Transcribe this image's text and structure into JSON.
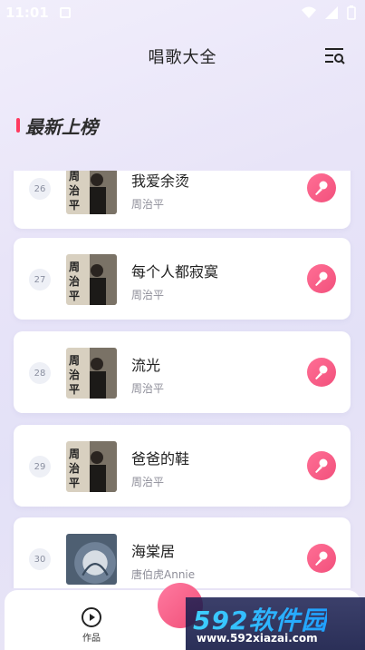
{
  "status": {
    "time": "11:01"
  },
  "header": {
    "title": "唱歌大全"
  },
  "section": {
    "title": "最新上榜"
  },
  "songs": [
    {
      "rank": "26",
      "title": "我爱余烫",
      "artist": "周治平",
      "cover": "portrait"
    },
    {
      "rank": "27",
      "title": "每个人都寂寞",
      "artist": "周治平",
      "cover": "portrait"
    },
    {
      "rank": "28",
      "title": "流光",
      "artist": "周治平",
      "cover": "portrait"
    },
    {
      "rank": "29",
      "title": "爸爸的鞋",
      "artist": "周治平",
      "cover": "portrait"
    },
    {
      "rank": "30",
      "title": "海棠居",
      "artist": "唐伯虎Annie",
      "cover": "art"
    }
  ],
  "tabbar": {
    "works_label": "作品"
  },
  "watermark": {
    "logo": "592软件园",
    "url": "www.592xiazai.com"
  },
  "colors": {
    "accent": "#f2507c",
    "rank_bg": "#eef0f6",
    "bg": "#e8e4f8"
  },
  "icons": {
    "menu": "search-list-icon",
    "sing": "microphone-icon",
    "works": "play-circle-icon"
  }
}
